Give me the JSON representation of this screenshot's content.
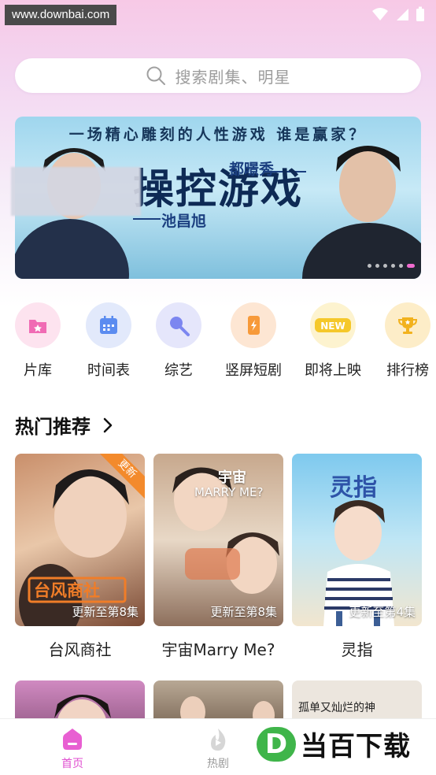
{
  "watermark": "www.downbai.com",
  "search": {
    "placeholder": "搜索剧集、明星"
  },
  "banner": {
    "slogan": "一场精心雕刻的人性游戏 谁是赢家？",
    "title": "操控游戏",
    "actor1": "都暻秀",
    "actor2": "池昌旭"
  },
  "quick_nav": [
    {
      "label": "片库",
      "icon": "library-icon",
      "color": "#f06bb4"
    },
    {
      "label": "时间表",
      "icon": "calendar-icon",
      "color": "#5b8cf0"
    },
    {
      "label": "综艺",
      "icon": "variety-icon",
      "color": "#7c86f0"
    },
    {
      "label": "竖屏短剧",
      "icon": "short-drama-icon",
      "color": "#f79a3a"
    },
    {
      "label": "即将上映",
      "icon": "new-icon",
      "color": "#f5c82a"
    },
    {
      "label": "排行榜",
      "icon": "trophy-icon",
      "color": "#f2b21e"
    }
  ],
  "section": {
    "title": "热门推荐",
    "more": "›"
  },
  "cards": [
    {
      "name": "台风商社",
      "update": "更新至第8集",
      "poster_text": "台风商社",
      "tag": "更新"
    },
    {
      "name": "宇宙Marry Me?",
      "update": "更新至第8集",
      "poster_text": "宇宙",
      "poster_sub": "MARRY ME?"
    },
    {
      "name": "灵指",
      "update": "更新至第4集",
      "poster_text": "灵指"
    }
  ],
  "row2_caption": "孤单又灿烂的神",
  "tabbar": {
    "home": "首页",
    "hot": "热剧"
  },
  "brand": {
    "badge": "D",
    "text": "当百下载"
  },
  "colors": {
    "accent": "#e04fd0",
    "tab_inactive": "#9b9b9b"
  }
}
